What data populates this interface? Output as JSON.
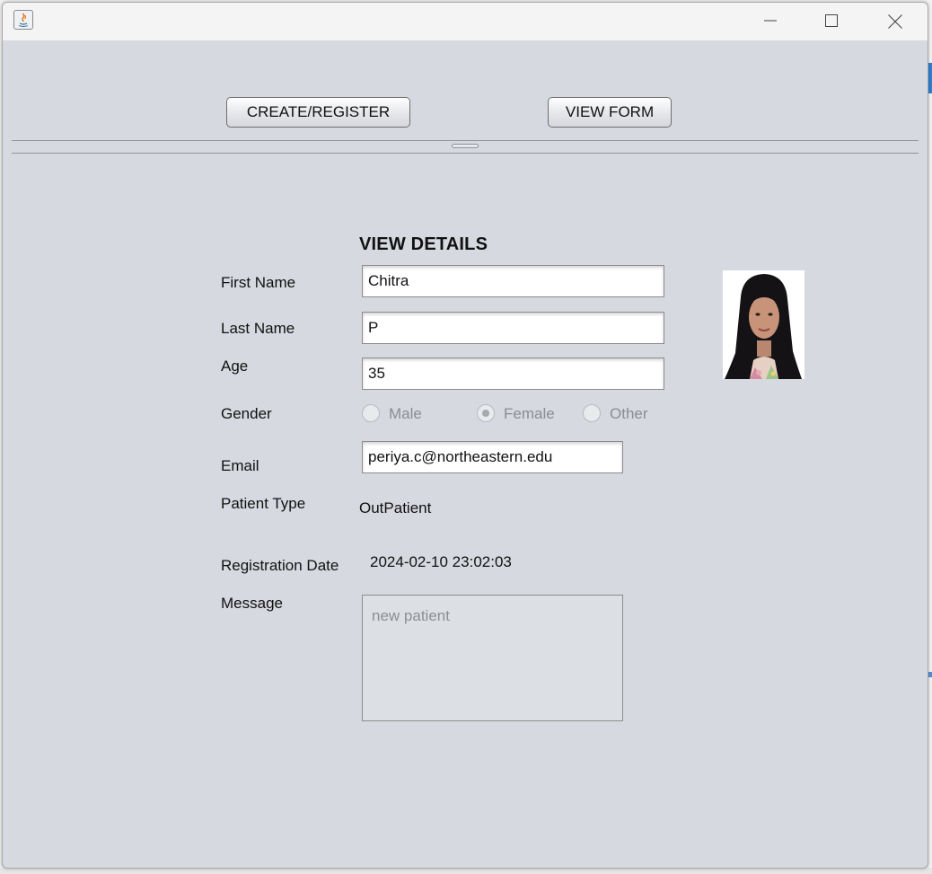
{
  "window": {
    "controls": {
      "minimize_icon": "minimize-icon",
      "maximize_icon": "maximize-icon",
      "close_icon": "close-icon"
    }
  },
  "toolbar": {
    "create_register_label": "CREATE/REGISTER",
    "view_form_label": "VIEW FORM"
  },
  "form": {
    "heading": "VIEW DETAILS",
    "first_name": {
      "label": "First Name",
      "value": "Chitra"
    },
    "last_name": {
      "label": "Last Name",
      "value": "P"
    },
    "age": {
      "label": "Age",
      "value": "35"
    },
    "gender": {
      "label": "Gender",
      "options": [
        "Male",
        "Female",
        "Other"
      ],
      "selected": "Female"
    },
    "email": {
      "label": "Email",
      "value": "periya.c@northeastern.edu"
    },
    "patient_type": {
      "label": "Patient Type",
      "value": "OutPatient"
    },
    "registration_date": {
      "label": "Registration Date",
      "value": "2024-02-10 23:02:03"
    },
    "message": {
      "label": "Message",
      "value": "new patient"
    }
  },
  "colors": {
    "panel_bg": "#d6d9e0",
    "titlebar_bg": "#f4f4f4",
    "disabled_text": "#8a8d92"
  }
}
